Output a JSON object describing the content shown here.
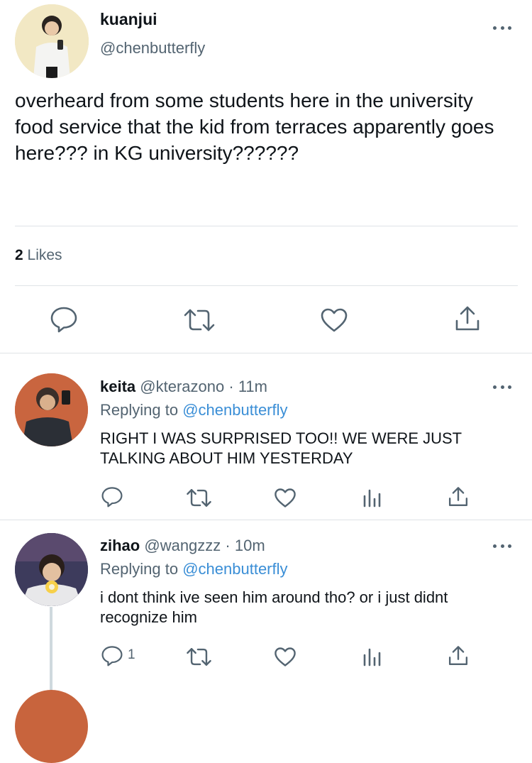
{
  "main_tweet": {
    "display_name": "kuanjui",
    "handle": "@chenbutterfly",
    "text": "overheard from some students here in the university food service that the kid from terraces apparently goes here??? in KG university??????",
    "likes_count": "2",
    "likes_label": "Likes",
    "actions": [
      "reply-icon",
      "retweet-icon",
      "like-icon",
      "share-icon"
    ]
  },
  "replies": [
    {
      "display_name": "keita",
      "handle": "@kterazono",
      "separator": "·",
      "time": "11m",
      "replying_label": "Replying to",
      "replying_to": "@chenbutterfly",
      "text": "RIGHT I WAS SURPRISED TOO!! WE WERE JUST TALKING ABOUT HIM YESTERDAY",
      "reply_count": "",
      "actions": [
        "reply-icon",
        "retweet-icon",
        "like-icon",
        "analytics-icon",
        "share-icon"
      ]
    },
    {
      "display_name": "zihao",
      "handle": "@wangzzz",
      "separator": "·",
      "time": "10m",
      "replying_label": "Replying to",
      "replying_to": "@chenbutterfly",
      "text": "i dont think ive seen him around tho? or i just didnt recognize him",
      "reply_count": "1",
      "actions": [
        "reply-icon",
        "retweet-icon",
        "like-icon",
        "analytics-icon",
        "share-icon"
      ]
    }
  ],
  "colors": {
    "text": "#0f1419",
    "muted": "#536471",
    "link": "#3a8ed6",
    "divider": "#dfe3e6",
    "icon": "#536471"
  }
}
